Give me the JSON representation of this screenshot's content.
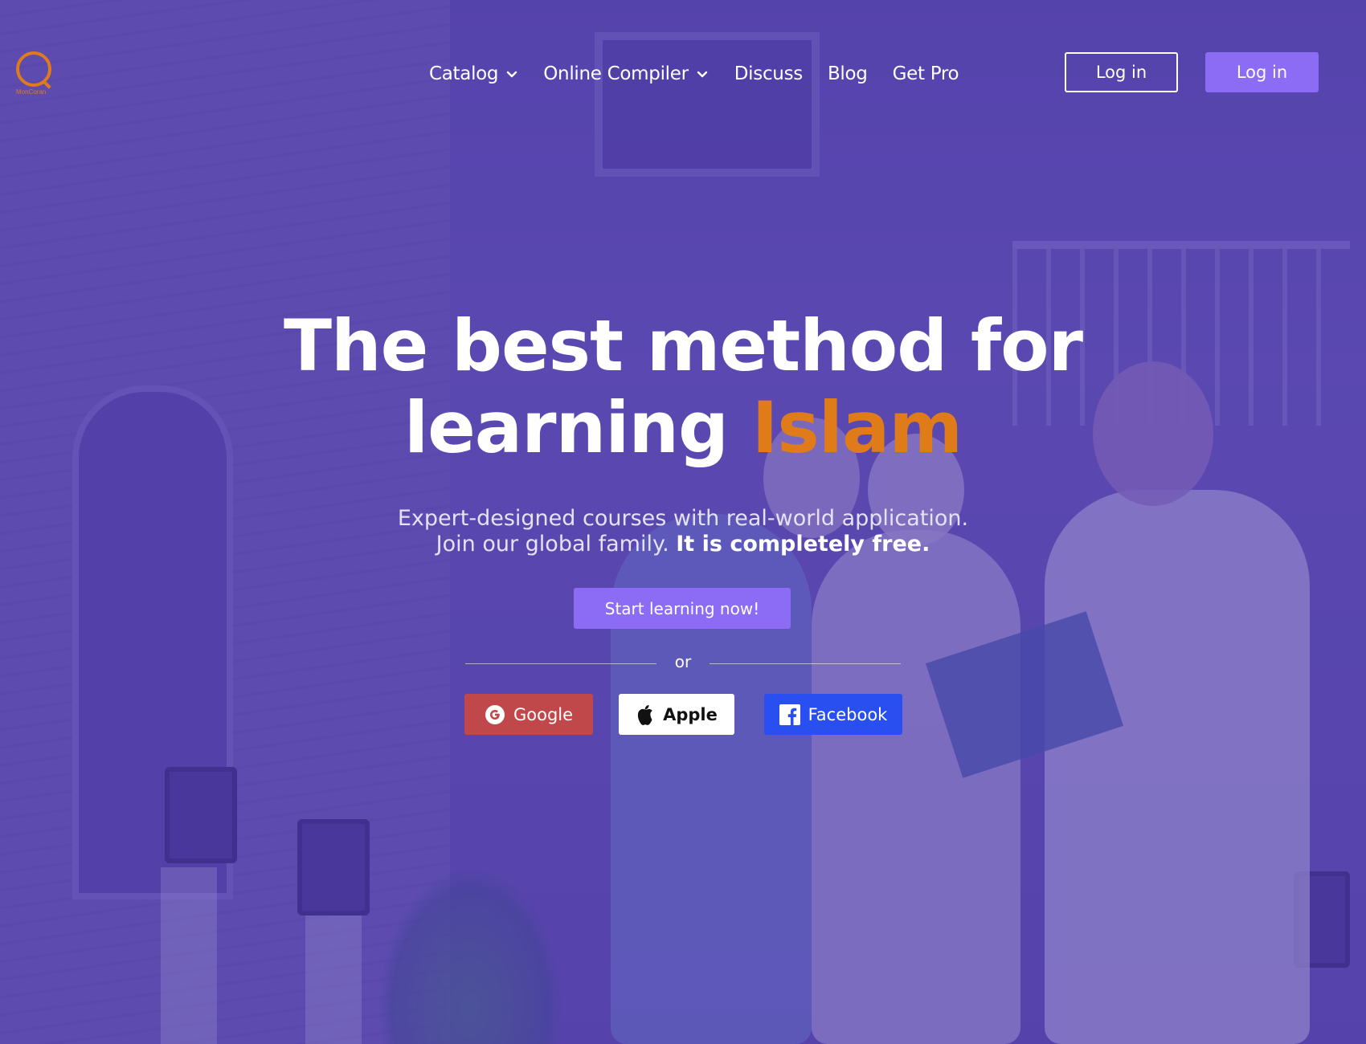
{
  "brand": {
    "logo_text": "MonCoran",
    "accent_color": "#e07b1a",
    "primary_color": "#8c6cf5"
  },
  "nav": {
    "items": [
      {
        "label": "Catalog",
        "has_dropdown": true
      },
      {
        "label": "Online Compiler",
        "has_dropdown": true
      },
      {
        "label": "Discuss",
        "has_dropdown": false
      },
      {
        "label": "Blog",
        "has_dropdown": false
      },
      {
        "label": "Get Pro",
        "has_dropdown": false
      }
    ],
    "login_outline_label": "Log in",
    "login_filled_label": "Log in"
  },
  "hero": {
    "title_line1": "The best method for",
    "title_line2_plain": "learning ",
    "title_line2_accent": "Islam",
    "subtitle_line1": "Expert-designed courses with real-world application.",
    "subtitle_line2_plain": "Join our global family. ",
    "subtitle_line2_bold": "It is completely free.",
    "cta_label": "Start learning now!",
    "divider_text": "or"
  },
  "social": {
    "google_label": "Google",
    "apple_label": "Apple",
    "facebook_label": "Facebook",
    "google_color": "#c1484a",
    "facebook_color": "#2a4ff0"
  }
}
